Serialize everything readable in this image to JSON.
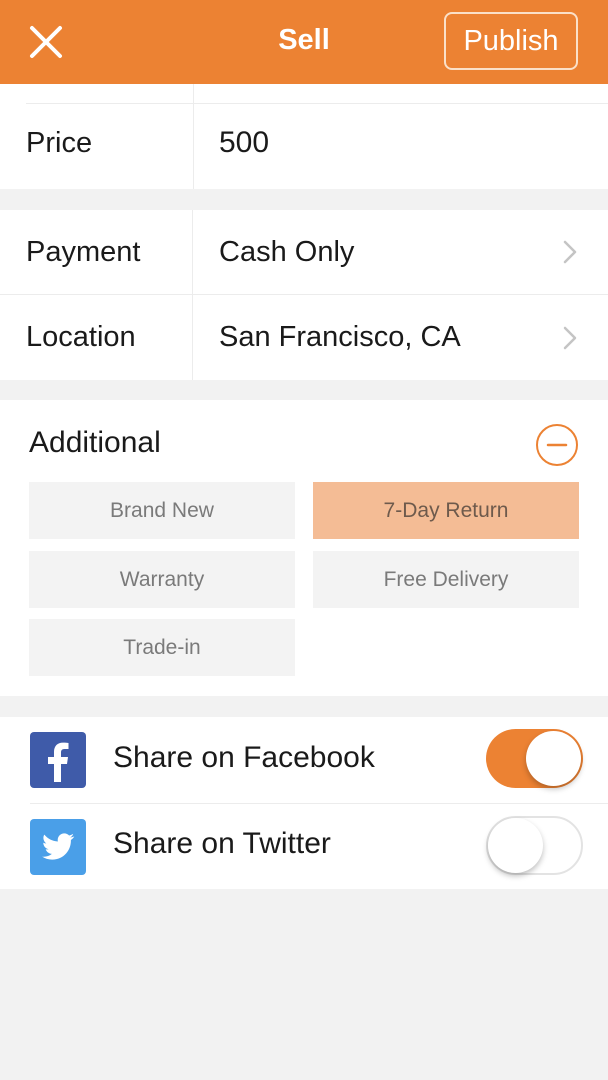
{
  "navbar": {
    "close_icon": "close-icon",
    "title": "Sell",
    "publish_label": "Publish",
    "accent_color": "#ec8233"
  },
  "price": {
    "label": "Price",
    "value": "500"
  },
  "details": [
    {
      "label": "Payment",
      "value": "Cash Only"
    },
    {
      "label": "Location",
      "value": "San Francisco, CA"
    }
  ],
  "additional": {
    "title": "Additional",
    "collapse_icon": "minus-circle-icon",
    "tags": [
      {
        "label": "Brand New",
        "selected": false
      },
      {
        "label": "7-Day Return",
        "selected": true
      },
      {
        "label": "Warranty",
        "selected": false
      },
      {
        "label": "Free Delivery",
        "selected": false
      },
      {
        "label": "Trade-in",
        "selected": false
      }
    ]
  },
  "share": [
    {
      "label": "Share on Facebook",
      "icon": "facebook-icon",
      "enabled": true,
      "color": "#3f5ba9"
    },
    {
      "label": "Share on Twitter",
      "icon": "twitter-icon",
      "enabled": false,
      "color": "#4a9fe8"
    }
  ]
}
